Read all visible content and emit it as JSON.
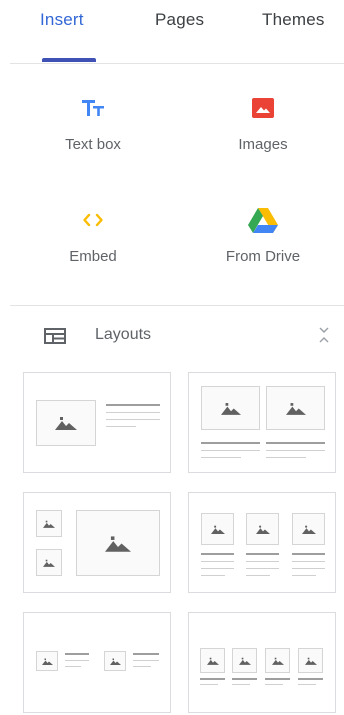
{
  "tabs": [
    {
      "label": "Insert",
      "active": true
    },
    {
      "label": "Pages",
      "active": false
    },
    {
      "label": "Themes",
      "active": false
    }
  ],
  "insert_tools": {
    "text_box": {
      "label": "Text box",
      "icon": "text-box-icon",
      "color": "#4285f4"
    },
    "images": {
      "label": "Images",
      "icon": "image-icon",
      "color": "#ea4335"
    },
    "embed": {
      "label": "Embed",
      "icon": "embed-icon",
      "color": "#fbbc04"
    },
    "from_drive": {
      "label": "From Drive",
      "icon": "google-drive-icon"
    }
  },
  "layouts": {
    "label": "Layouts",
    "icon": "layouts-icon",
    "collapse_icon": "collapse-icon",
    "cards": [
      {
        "name": "image-left-text-right"
      },
      {
        "name": "two-images-with-captions"
      },
      {
        "name": "two-small-images-one-large-image"
      },
      {
        "name": "three-images-with-captions"
      },
      {
        "name": "two-images-with-text"
      },
      {
        "name": "four-images-with-captions"
      }
    ]
  },
  "colors": {
    "accent": "#3367d6",
    "tab_indicator": "#3f51b5"
  }
}
